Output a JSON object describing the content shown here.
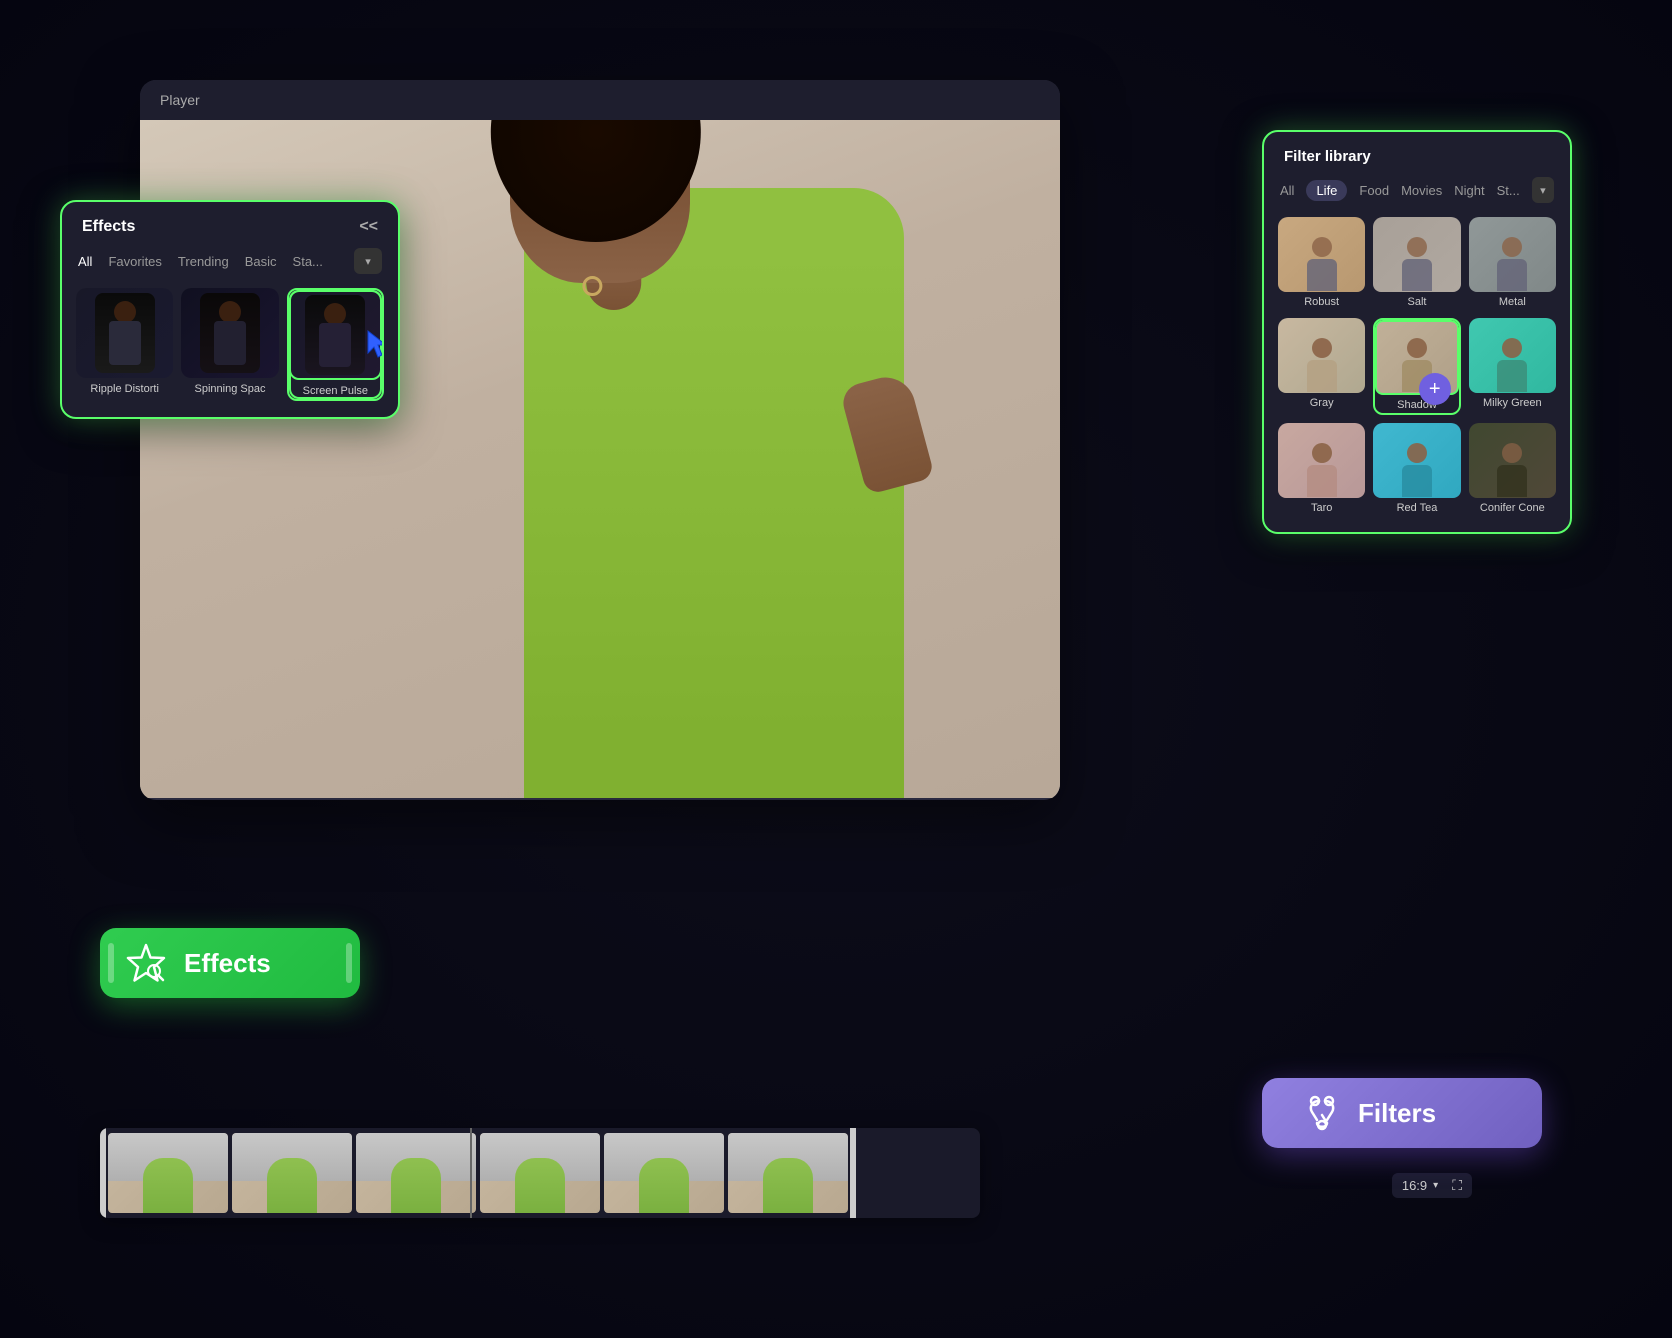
{
  "player": {
    "title": "Player",
    "aspect_ratio": "16:9"
  },
  "effects_panel": {
    "title": "Effects",
    "close_icon": "<<",
    "tabs": [
      {
        "label": "All",
        "active": false
      },
      {
        "label": "Favorites",
        "active": false
      },
      {
        "label": "Trending",
        "active": false
      },
      {
        "label": "Basic",
        "active": false
      },
      {
        "label": "Sta...",
        "active": false
      }
    ],
    "items": [
      {
        "label": "Ripple Distorti",
        "selected": false
      },
      {
        "label": "Spinning Spac",
        "selected": false
      },
      {
        "label": "Screen Pulse",
        "selected": true
      }
    ]
  },
  "filter_panel": {
    "title": "Filter library",
    "tabs": [
      {
        "label": "All",
        "active": false
      },
      {
        "label": "Life",
        "active": true
      },
      {
        "label": "Food",
        "active": false
      },
      {
        "label": "Movies",
        "active": false
      },
      {
        "label": "Night",
        "active": false
      },
      {
        "label": "St...",
        "active": false
      }
    ],
    "items": [
      {
        "label": "Robust",
        "row": 0
      },
      {
        "label": "Salt",
        "row": 0
      },
      {
        "label": "Metal",
        "row": 0
      },
      {
        "label": "Gray",
        "row": 1
      },
      {
        "label": "Shadow",
        "row": 1,
        "selected": true,
        "has_add": true
      },
      {
        "label": "Milky Green",
        "row": 1
      },
      {
        "label": "Taro",
        "row": 2
      },
      {
        "label": "Red Tea",
        "row": 2
      },
      {
        "label": "Conifer Cone",
        "row": 2
      }
    ]
  },
  "effects_pill": {
    "label": "Effects",
    "icon": "star"
  },
  "filters_pill": {
    "label": "Filters",
    "icon": "recycle"
  }
}
